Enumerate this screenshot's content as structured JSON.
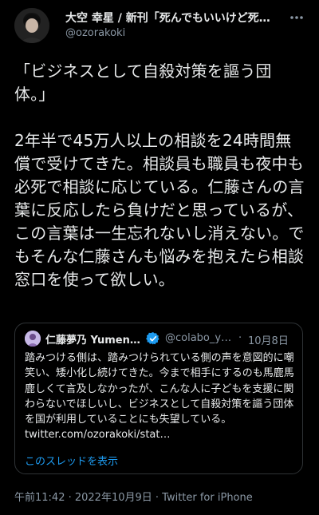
{
  "author": {
    "display_name": "大空 幸星 / 新刊「死んでもいいけど死…",
    "handle": "@ozorakoki"
  },
  "tweet": {
    "text": "「ビジネスとして自殺対策を謳う団体。」\n\n2年半で45万人以上の相談を24時間無償で受けてきた。相談員も職員も夜中も必死で相談に応じている。仁藤さんの言葉に反応したら負けだと思っているが、この言葉は一生忘れないし消えない。でもそんな仁藤さんも悩みを抱えたら相談窓口を使って欲しい。"
  },
  "quote": {
    "name": "仁藤夢乃 Yumen…",
    "handle": "@colabo_yu…",
    "separator": "·",
    "date": "10月8日",
    "text": "踏みつける側は、踏みつけられている側の声を意図的に嘲笑い、矮小化し続けてきた。今まで相手にするのも馬鹿馬鹿しくて言及しなかったが、こんな人に子どもを支援に関わらないでほしいし、ビジネスとして自殺対策を謳う団体を国が利用していることにも失望している。 twitter.com/ozorakoki/stat…",
    "thread_link": "このスレッドを表示"
  },
  "meta": {
    "timestamp": "午前11:42 · 2022年10月9日 · Twitter for iPhone"
  },
  "icons": {
    "more": "more-icon",
    "verified": "verified-badge-icon"
  },
  "colors": {
    "background": "#000000",
    "text": "#e7e9ea",
    "secondary": "#8b98a5",
    "link": "#1d9bf0",
    "verified": "#1d9bf0"
  }
}
